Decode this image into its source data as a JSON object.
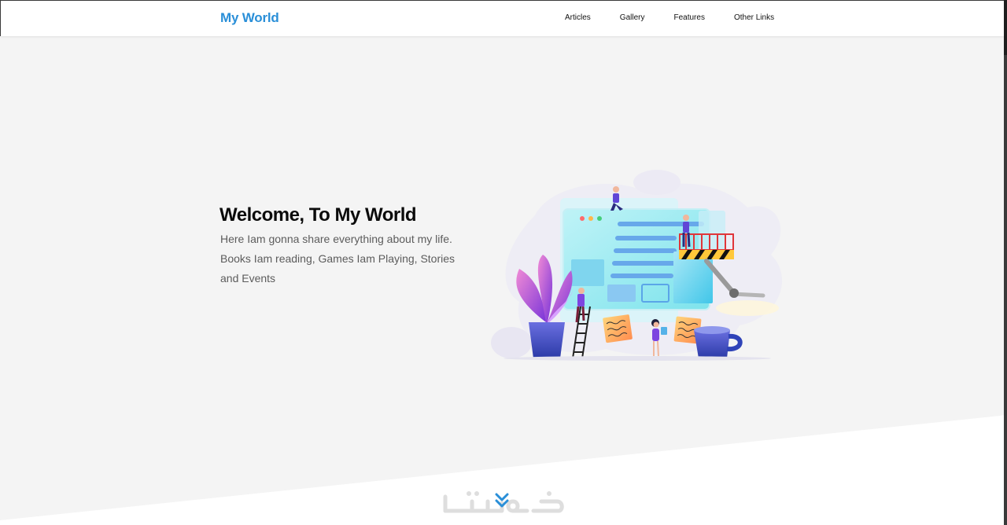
{
  "header": {
    "logo": "My World",
    "nav": [
      "Articles",
      "Gallery",
      "Features",
      "Other Links"
    ]
  },
  "hero": {
    "title": "Welcome, To My World",
    "description": "Here Iam gonna share everything about my life. Books Iam reading, Games Iam Playing, Stories and Events",
    "illustration_icon": "web-development-team-illustration"
  },
  "scroll_down": {
    "icon": "double-chevron-down-icon"
  },
  "watermark": {
    "icon": "khamsat-logo"
  },
  "colors": {
    "brand": "#2a8fd8",
    "background": "#f4f4f4",
    "title": "#0b0b0b",
    "text": "#5c5c5c"
  }
}
